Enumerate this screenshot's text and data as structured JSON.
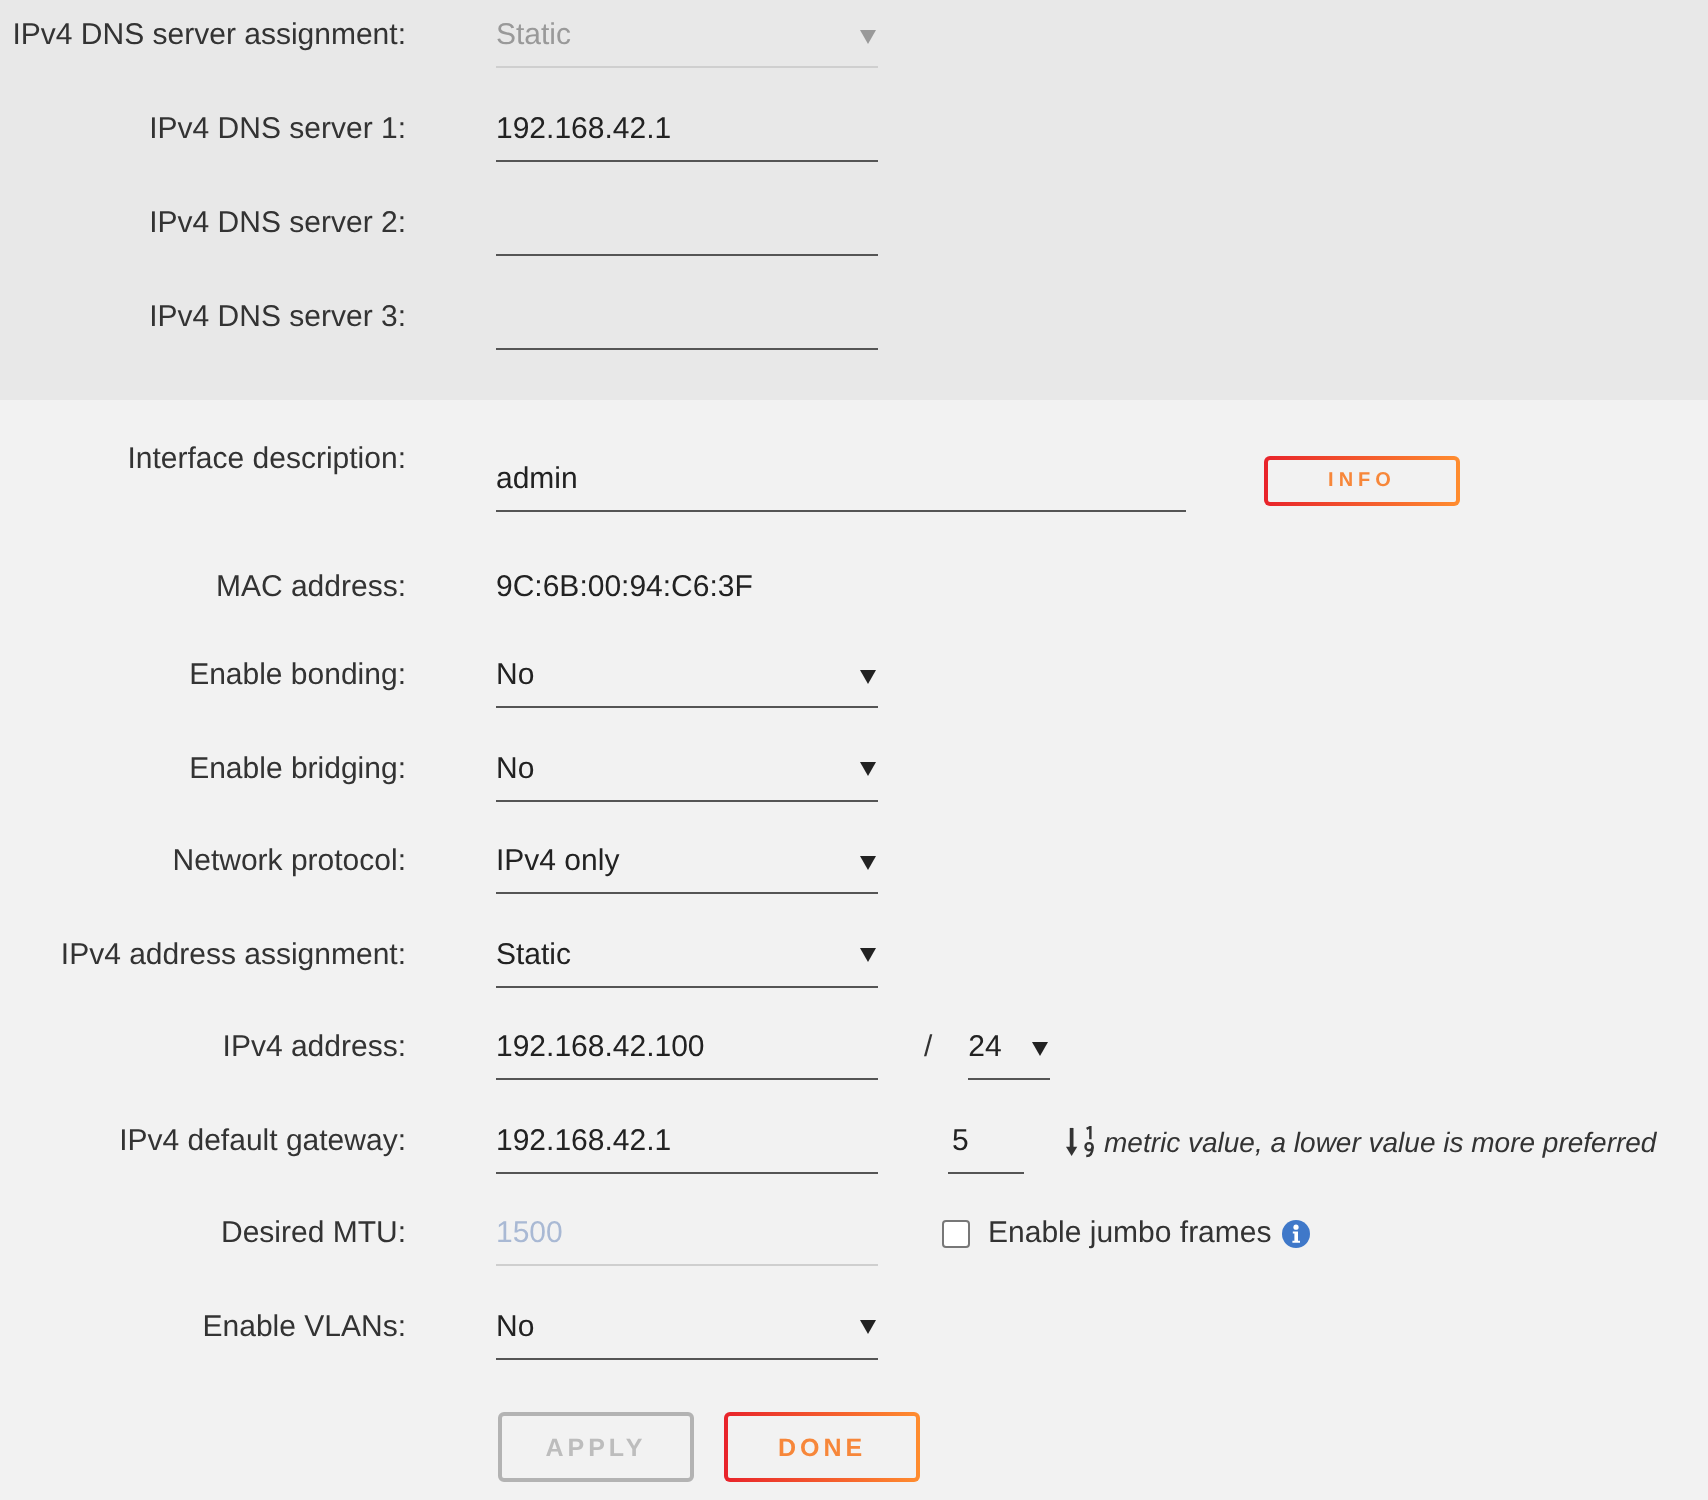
{
  "dns_section": {
    "rows": [
      {
        "kind": "select",
        "label": "IPv4 DNS server assignment:",
        "value": "Static",
        "disabled": true
      },
      {
        "kind": "input",
        "label": "IPv4 DNS server 1:",
        "value": "192.168.42.1",
        "disabled": false
      },
      {
        "kind": "input",
        "label": "IPv4 DNS server 2:",
        "disabled": false
      },
      {
        "kind": "input",
        "label": "IPv4 DNS server 3:",
        "disabled": false
      }
    ]
  },
  "interface_section": {
    "rows": [
      {
        "kind": "textarea",
        "label": "Interface description:",
        "value": "admin",
        "disabled": false,
        "button": {
          "label": "INFO"
        }
      },
      {
        "kind": "text",
        "label": "MAC address:",
        "value": "9C:6B:00:94:C6:3F",
        "disabled": false
      },
      {
        "kind": "select",
        "label": "Enable bonding:",
        "value": "No",
        "disabled": false
      },
      {
        "kind": "select",
        "label": "Enable bridging:",
        "value": "No",
        "disabled": false
      },
      {
        "kind": "select",
        "label": "Network protocol:",
        "value": "IPv4 only",
        "disabled": false
      },
      {
        "kind": "select",
        "label": "IPv4 address assignment:",
        "value": "Static",
        "disabled": false
      },
      {
        "kind": "input",
        "label": "IPv4 address:",
        "value": "192.168.42.100",
        "disabled": false,
        "prefix": {
          "separator": "/",
          "value": "24"
        }
      },
      {
        "kind": "input",
        "label": "IPv4 default gateway:",
        "value": "192.168.42.1",
        "disabled": false,
        "metric": {
          "value": "5",
          "hint": "metric value, a lower value is more preferred"
        }
      },
      {
        "kind": "input",
        "label": "Desired MTU:",
        "placeholder": "1500",
        "disabled": true,
        "checkbox": {
          "label": "Enable jumbo frames",
          "checked": false
        }
      },
      {
        "kind": "select",
        "label": "Enable VLANs:",
        "value": "No",
        "disabled": false
      }
    ]
  },
  "buttons": [
    {
      "label": "APPLY",
      "disabled": true
    },
    {
      "label": "DONE",
      "disabled": false
    }
  ]
}
